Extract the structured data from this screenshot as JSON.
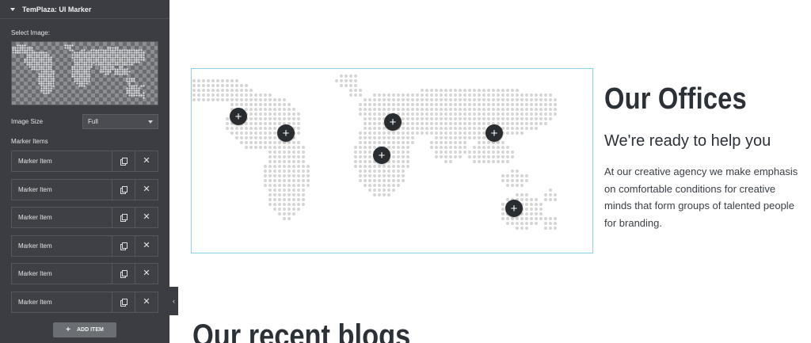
{
  "panel": {
    "title": "TemPlaza: UI Marker",
    "select_image_label": "Select Image:",
    "image_size_label": "Image Size",
    "image_size_value": "Full",
    "marker_items_label": "Marker Items",
    "marker_items": [
      {
        "label": "Marker Item"
      },
      {
        "label": "Marker Item"
      },
      {
        "label": "Marker Item"
      },
      {
        "label": "Marker Item"
      },
      {
        "label": "Marker Item"
      },
      {
        "label": "Marker Item"
      }
    ],
    "add_item_label": "ADD ITEM",
    "add_icon": "+",
    "collapse_icon": "‹"
  },
  "preview": {
    "marker_icon": "+",
    "heading": "Our Offices",
    "subheading": "We're ready to help you",
    "body": "At our creative agency we make emphasis on comfortable conditions for creative minds that form groups of talented people for branding.",
    "blog_heading": "Our recent blogs"
  },
  "colors": {
    "sidebar_bg": "#3b3d42",
    "map_border": "#8ad4ea",
    "marker_bg": "#2a2d30",
    "heading": "#2b3137"
  }
}
